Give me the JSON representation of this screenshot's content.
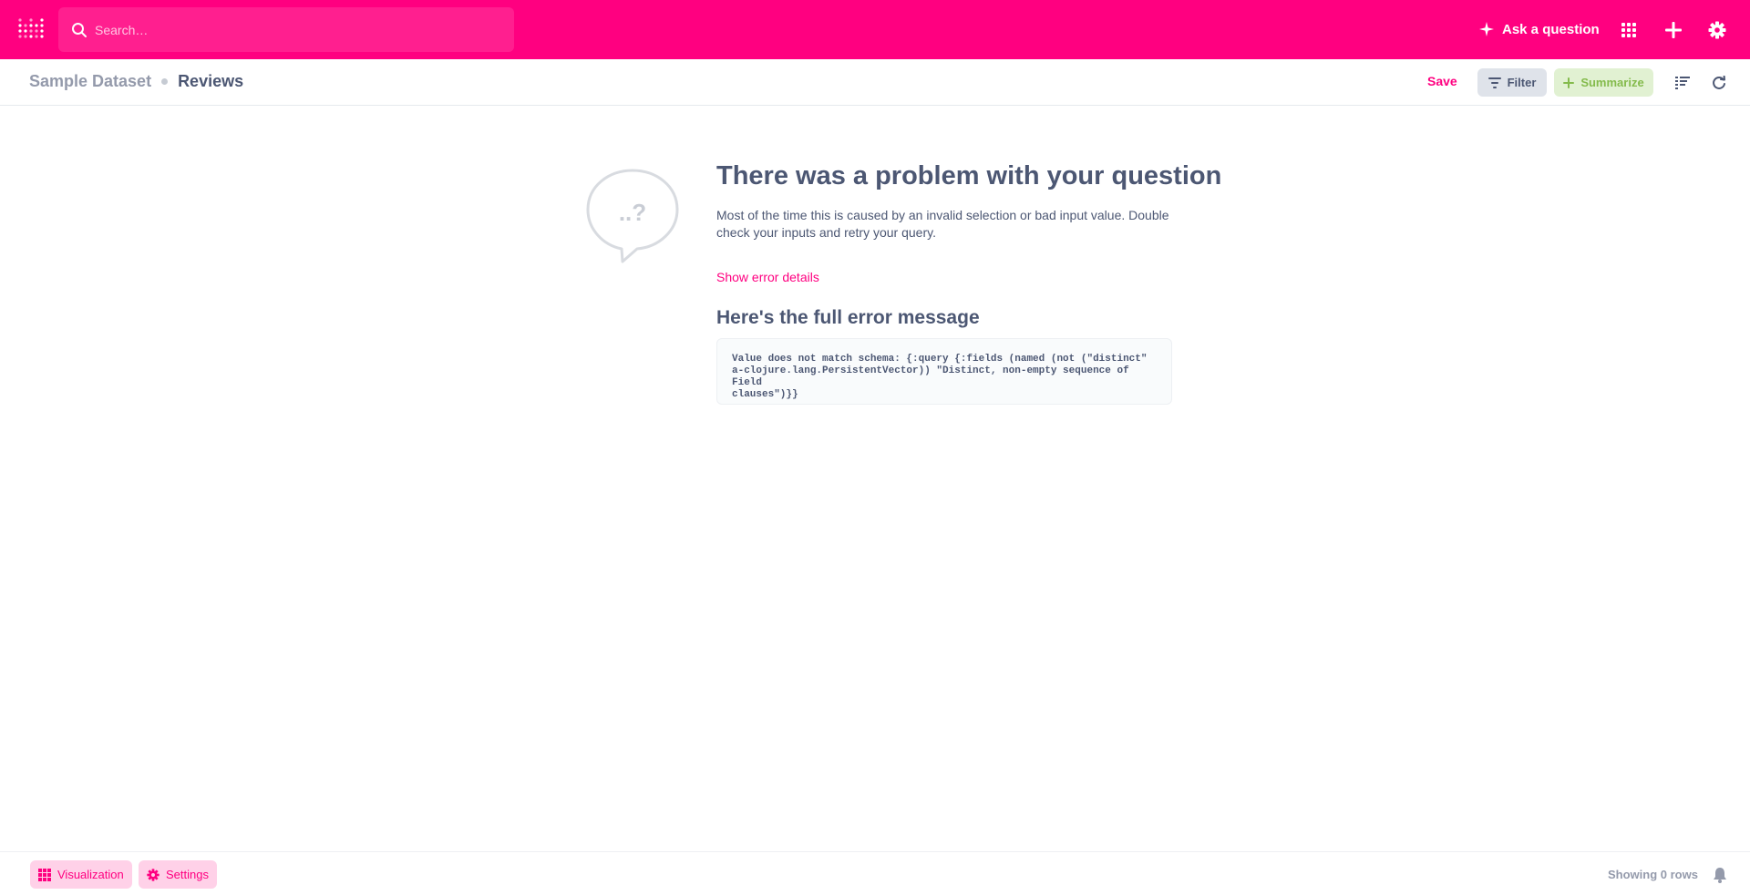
{
  "nav": {
    "search_placeholder": "Search…",
    "ask_label": "Ask a question",
    "brand_color": "#ff0080"
  },
  "header": {
    "breadcrumb_dataset": "Sample Dataset",
    "breadcrumb_table": "Reviews",
    "save_label": "Save",
    "filter_label": "Filter",
    "summarize_label": "Summarize"
  },
  "error": {
    "bubble_text": "..?",
    "title": "There was a problem with your question",
    "description": "Most of the time this is caused by an invalid selection or bad input value. Double check your inputs and retry your query.",
    "show_details_label": "Show error details",
    "full_message_title": "Here's the full error message",
    "message": "Value does not match schema: {:query {:fields (named (not (\"distinct\"\na-clojure.lang.PersistentVector)) \"Distinct, non-empty sequence of Field\nclauses\")}}"
  },
  "footer": {
    "visualization_label": "Visualization",
    "settings_label": "Settings",
    "row_count": "Showing 0 rows"
  }
}
